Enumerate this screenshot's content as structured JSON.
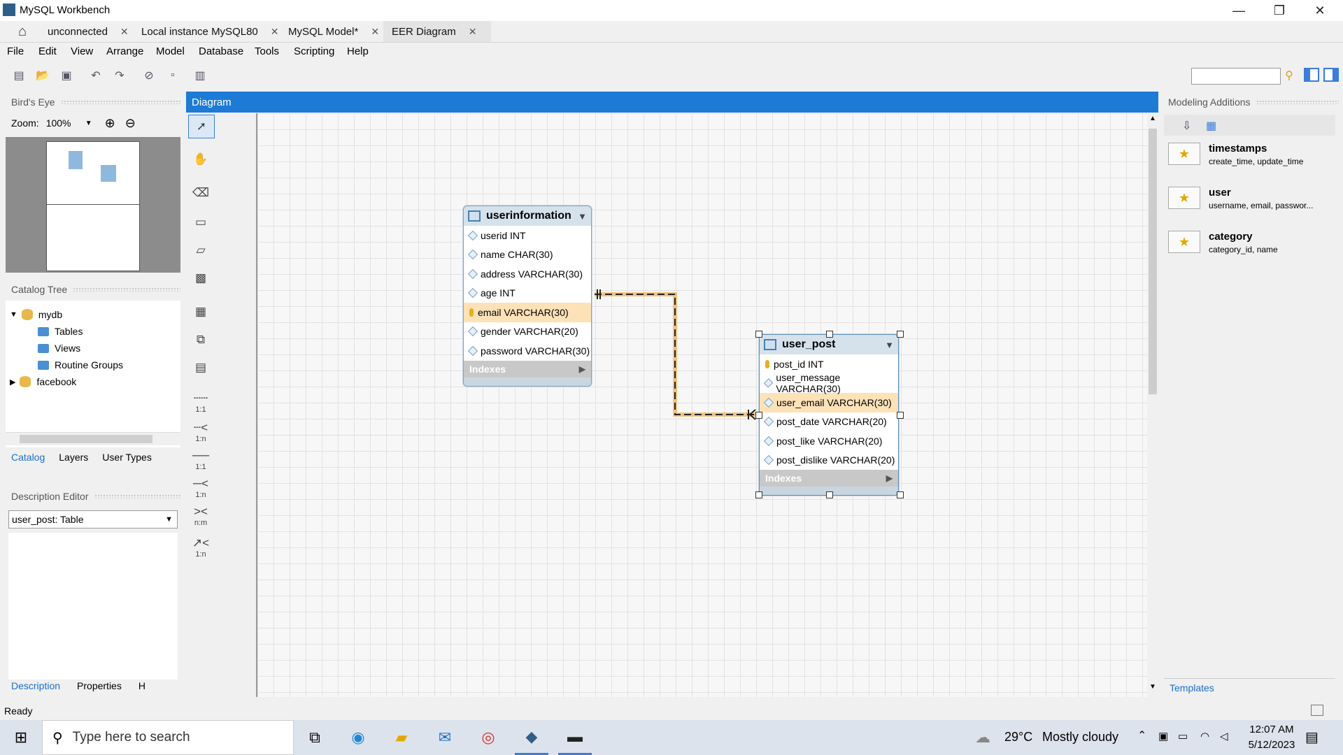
{
  "window": {
    "title": "MySQL Workbench",
    "controls": [
      "—",
      "❐",
      "✕"
    ]
  },
  "tabs": [
    {
      "label": "unconnected"
    },
    {
      "label": "Local instance MySQL80"
    },
    {
      "label": "MySQL Model*"
    },
    {
      "label": "EER Diagram"
    }
  ],
  "menu": [
    "File",
    "Edit",
    "View",
    "Arrange",
    "Model",
    "Database",
    "Tools",
    "Scripting",
    "Help"
  ],
  "toolbar": {
    "search_placeholder": ""
  },
  "birds_eye": {
    "title": "Bird's Eye",
    "zoom_label": "Zoom:",
    "zoom_value": "100%"
  },
  "catalog": {
    "title": "Catalog Tree",
    "items": [
      {
        "label": "mydb",
        "children": [
          "Tables",
          "Views",
          "Routine Groups"
        ]
      },
      {
        "label": "facebook"
      }
    ],
    "tabs": [
      "Catalog",
      "Layers",
      "User Types"
    ]
  },
  "description_editor": {
    "title": "Description Editor",
    "selected": "user_post: Table"
  },
  "bottom_tabs": [
    "Description",
    "Properties",
    "H"
  ],
  "diagram": {
    "title": "Diagram",
    "tools_rel": [
      "1:1",
      "1:n",
      "1:1",
      "1:n",
      "n:m",
      "1:n"
    ],
    "tables": [
      {
        "name": "userinformation",
        "columns": [
          {
            "label": "userid INT",
            "key": false,
            "highlight": false
          },
          {
            "label": "name CHAR(30)",
            "key": false,
            "highlight": false
          },
          {
            "label": "address VARCHAR(30)",
            "key": false,
            "highlight": false
          },
          {
            "label": "age INT",
            "key": false,
            "highlight": false
          },
          {
            "label": "email VARCHAR(30)",
            "key": true,
            "highlight": true
          },
          {
            "label": "gender VARCHAR(20)",
            "key": false,
            "highlight": false
          },
          {
            "label": "password VARCHAR(30)",
            "key": false,
            "highlight": false
          }
        ],
        "indexes_label": "Indexes"
      },
      {
        "name": "user_post",
        "columns": [
          {
            "label": "post_id INT",
            "key": true,
            "highlight": false
          },
          {
            "label": "user_message VARCHAR(30)",
            "key": false,
            "highlight": false
          },
          {
            "label": "user_email VARCHAR(30)",
            "key": false,
            "highlight": true
          },
          {
            "label": "post_date VARCHAR(20)",
            "key": false,
            "highlight": false
          },
          {
            "label": "post_like VARCHAR(20)",
            "key": false,
            "highlight": false
          },
          {
            "label": "post_dislike VARCHAR(20)",
            "key": false,
            "highlight": false
          }
        ],
        "indexes_label": "Indexes"
      }
    ]
  },
  "modeling_additions": {
    "title": "Modeling Additions",
    "templates": [
      {
        "name": "timestamps",
        "desc": "create_time, update_time"
      },
      {
        "name": "user",
        "desc": "username, email, passwor..."
      },
      {
        "name": "category",
        "desc": "category_id, name"
      }
    ],
    "tab": "Templates"
  },
  "status": "Ready",
  "taskbar": {
    "search_placeholder": "Type here to search",
    "weather_temp": "29°C",
    "weather_text": "Mostly cloudy",
    "time": "12:07 AM",
    "date": "5/12/2023"
  }
}
